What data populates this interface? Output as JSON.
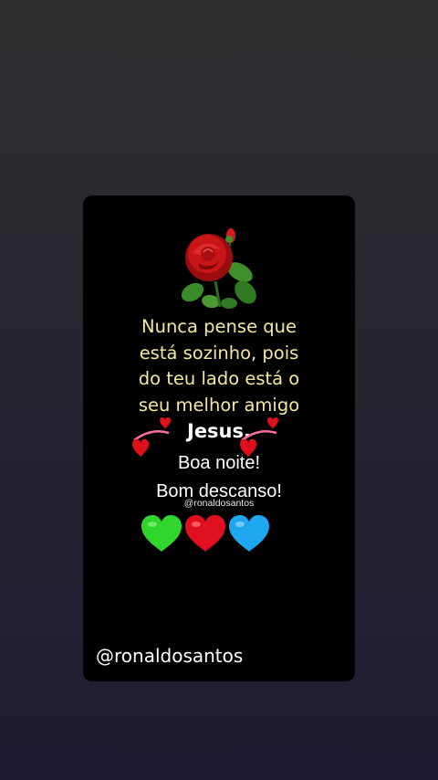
{
  "post": {
    "poem_lines": [
      "Nunca pense que",
      "está sozinho, pois",
      "do teu lado está o",
      "seu melhor amigo"
    ],
    "jesus": "Jesus.",
    "greeting": "Boa noite!",
    "farewell": "Bom descanso!",
    "watermark_small": "@ronaldosantos",
    "handle": "@ronaldosantos",
    "heart_colors": [
      "#31d62c",
      "#e01020",
      "#1ea6f0"
    ],
    "poem_color": "#f3e7a0"
  }
}
